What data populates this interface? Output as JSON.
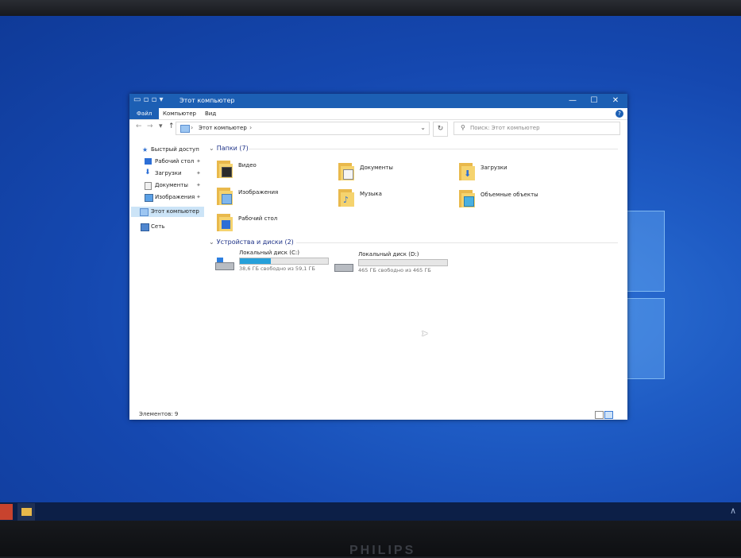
{
  "monitor": {
    "brand": "PHILIPS"
  },
  "window": {
    "title": "Этот компьютер",
    "controls": {
      "minimize": "—",
      "maximize": "☐",
      "close": "✕"
    },
    "ribbon_tabs": [
      "Файл",
      "Компьютер",
      "Вид"
    ],
    "help": "?"
  },
  "address": {
    "path": "Этот компьютер",
    "separator": "›",
    "search_placeholder": "Поиск: Этот компьютер"
  },
  "nav_pane": {
    "quick_access": "Быстрый доступ",
    "items": [
      {
        "label": "Рабочий стол",
        "icon": "desktop-icon",
        "pinned": true
      },
      {
        "label": "Загрузки",
        "icon": "download-icon",
        "pinned": true
      },
      {
        "label": "Документы",
        "icon": "document-icon",
        "pinned": true
      },
      {
        "label": "Изображения",
        "icon": "pictures-icon",
        "pinned": true
      }
    ],
    "this_pc": "Этот компьютер",
    "network": "Сеть"
  },
  "content": {
    "folders_header": "Папки (7)",
    "folders": [
      {
        "name": "Видео",
        "icon": "video-folder-icon"
      },
      {
        "name": "Документы",
        "icon": "documents-folder-icon"
      },
      {
        "name": "Загрузки",
        "icon": "downloads-folder-icon"
      },
      {
        "name": "Изображения",
        "icon": "pictures-folder-icon"
      },
      {
        "name": "Музыка",
        "icon": "music-folder-icon"
      },
      {
        "name": "Объемные объекты",
        "icon": "3d-objects-folder-icon"
      },
      {
        "name": "Рабочий стол",
        "icon": "desktop-folder-icon"
      }
    ],
    "drives_header": "Устройства и диски (2)",
    "drives": [
      {
        "name": "Локальный диск (C:)",
        "free_text": "38,6 ГБ свободно из 59,1 ГБ",
        "used_fraction": 0.35,
        "icon": "windows-drive-icon"
      },
      {
        "name": "Локальный диск (D:)",
        "free_text": "465 ГБ свободно из 465 ГБ",
        "used_fraction": 0.0,
        "icon": "drive-icon"
      }
    ]
  },
  "status": {
    "items_text": "Элементов: 9"
  },
  "colors": {
    "accent": "#1c5fb4",
    "folder": "#f5d36e",
    "progress": "#26a0da",
    "desktop": "#1548b0"
  }
}
